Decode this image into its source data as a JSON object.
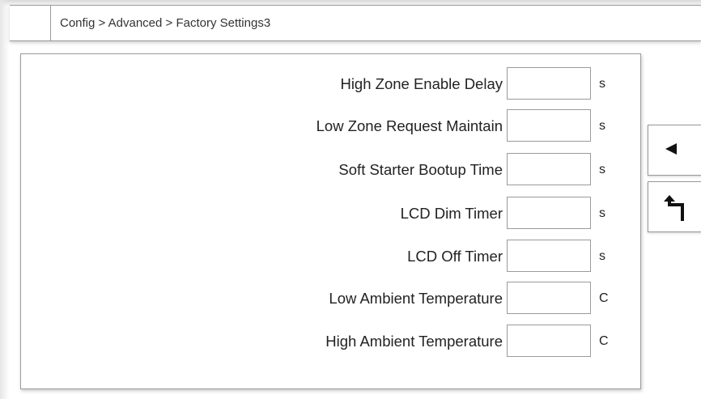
{
  "header": {
    "breadcrumb": "Config > Advanced > Factory Settings3"
  },
  "settings": [
    {
      "label": "High Zone Enable Delay",
      "value": "",
      "unit": "s"
    },
    {
      "label": "Low Zone Request Maintain",
      "value": "",
      "unit": "s"
    },
    {
      "label": "Soft Starter Bootup Time",
      "value": "",
      "unit": "s"
    },
    {
      "label": "LCD Dim Timer",
      "value": "",
      "unit": "s"
    },
    {
      "label": "LCD Off Timer",
      "value": "",
      "unit": "s"
    },
    {
      "label": "Low Ambient Temperature",
      "value": "",
      "unit": "C"
    },
    {
      "label": "High Ambient Temperature",
      "value": "",
      "unit": "C"
    }
  ],
  "nav": {
    "prev_icon": "left-triangle-arrow-icon",
    "back_icon": "return-arrow-icon"
  },
  "colors": {
    "border": "#9a9a9a",
    "icon": "#111111",
    "text": "#222222"
  }
}
